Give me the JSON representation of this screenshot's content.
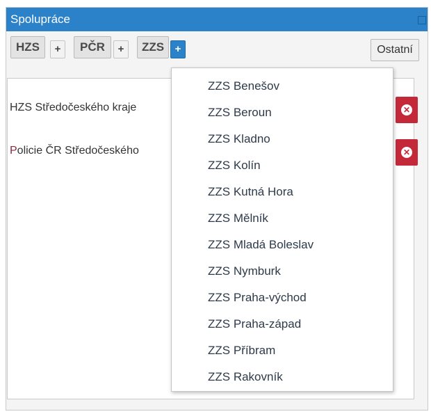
{
  "window": {
    "title": "Spolupráce"
  },
  "toolbar": {
    "groups": [
      {
        "label": "HZS",
        "add": "+"
      },
      {
        "label": "PČR",
        "add": "+"
      },
      {
        "label": "ZZS",
        "add": "+"
      }
    ],
    "other_label": "Ostatní",
    "active_add_color": "#2c82c9"
  },
  "list": {
    "items": [
      {
        "prefix": "",
        "text": "HZS Středočeského kraje"
      },
      {
        "prefix": "P",
        "text": "olicie ČR Středočeského"
      }
    ],
    "remove_icon": "remove-circle-icon",
    "remove_color": "#c4293a"
  },
  "dropdown": {
    "items": [
      "ZZS Benešov",
      "ZZS Beroun",
      "ZZS Kladno",
      "ZZS Kolín",
      "ZZS Kutná Hora",
      "ZZS Mělník",
      "ZZS Mladá Boleslav",
      "ZZS Nymburk",
      "ZZS Praha-východ",
      "ZZS Praha-západ",
      "ZZS Příbram",
      "ZZS Rakovník"
    ]
  }
}
